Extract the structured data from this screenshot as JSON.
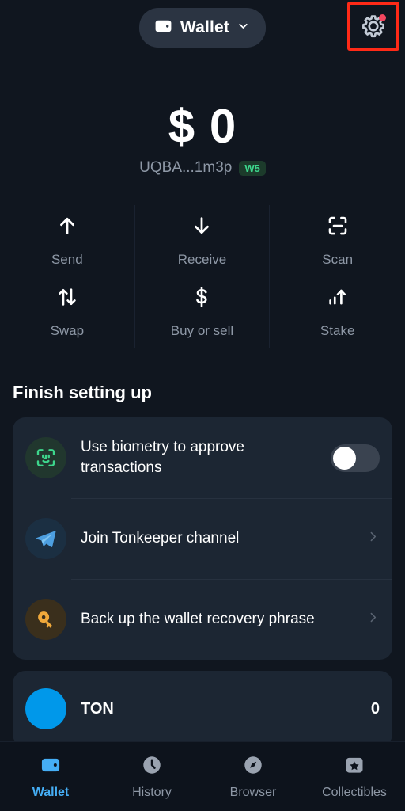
{
  "header": {
    "wallet_button_label": "Wallet",
    "wallet_icon": "wallet-icon",
    "chevron_icon": "chevron-down-icon",
    "settings_icon": "gear-icon",
    "settings_has_notification": true,
    "highlight_color": "#FF2A17",
    "notification_color": "#F5475F"
  },
  "balance": {
    "amount": "$ 0",
    "address": "UQBA...1m3p",
    "version_badge": "W5",
    "badge_bg": "#1C3B2B",
    "badge_fg": "#3DD68C"
  },
  "actions": [
    {
      "label": "Send",
      "icon": "arrow-up-icon"
    },
    {
      "label": "Receive",
      "icon": "arrow-down-icon"
    },
    {
      "label": "Scan",
      "icon": "scan-icon"
    },
    {
      "label": "Swap",
      "icon": "swap-arrows-icon"
    },
    {
      "label": "Buy or sell",
      "icon": "dollar-icon"
    },
    {
      "label": "Stake",
      "icon": "chart-up-icon"
    }
  ],
  "setup": {
    "title": "Finish setting up",
    "rows": [
      {
        "label": "Use biometry to approve transactions",
        "icon": "face-id-icon",
        "icon_bg": "#21372E",
        "control": "toggle",
        "toggle_on": false
      },
      {
        "label": "Join Tonkeeper channel",
        "icon": "telegram-icon",
        "icon_bg": "#1B2F42",
        "control": "chevron",
        "chevron_icon": "chevron-right-icon"
      },
      {
        "label": "Back up the wallet recovery phrase",
        "icon": "key-icon",
        "icon_bg": "#3A2F1C",
        "control": "chevron",
        "chevron_icon": "chevron-right-icon"
      }
    ]
  },
  "tokens": [
    {
      "name": "TON",
      "icon": "ton-icon",
      "icon_color": "#0098EA",
      "value": "0"
    }
  ],
  "bottom_nav": {
    "active_color": "#45AEF5",
    "items": [
      {
        "label": "Wallet",
        "icon": "wallet-icon",
        "active": true
      },
      {
        "label": "History",
        "icon": "clock-icon",
        "active": false
      },
      {
        "label": "Browser",
        "icon": "compass-icon",
        "active": false
      },
      {
        "label": "Collectibles",
        "icon": "star-badge-icon",
        "active": false
      }
    ]
  }
}
